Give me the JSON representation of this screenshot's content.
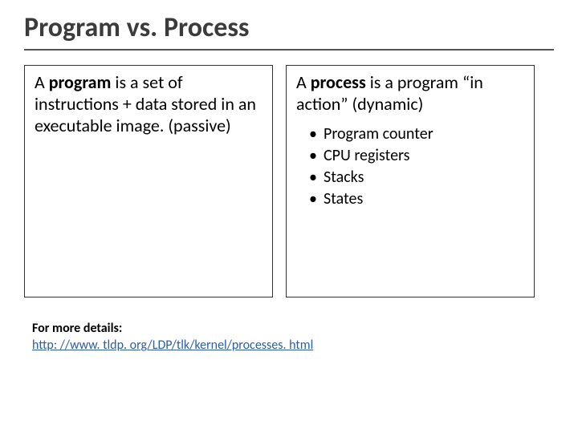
{
  "title": "Program vs. Process",
  "left": {
    "pre": "A ",
    "bold": "program",
    "post": " is a set of instructions + data stored in an executable image. (passive)"
  },
  "right": {
    "pre": "A ",
    "bold": "process",
    "post": " is a program “in action” (dynamic)",
    "bullets": [
      "Program counter",
      "CPU registers",
      "Stacks",
      "States"
    ]
  },
  "footer": {
    "label": "For more details:",
    "link_text": "http: //www. tldp. org/LDP/tlk/kernel/processes. html"
  }
}
